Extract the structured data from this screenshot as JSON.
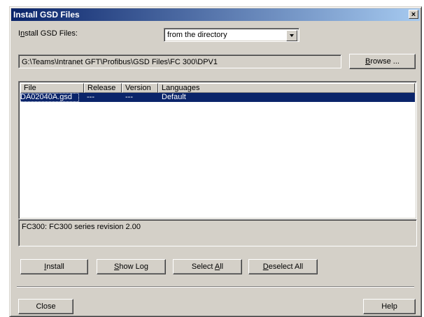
{
  "window": {
    "title": "Install GSD Files"
  },
  "install": {
    "label_prefix": "I",
    "label_accel": "n",
    "label_rest": "stall GSD Files:",
    "source_value": "from the directory"
  },
  "path": {
    "value": "G:\\Teams\\Intranet GFT\\Profibus\\GSD Files\\FC 300\\DPV1"
  },
  "browse": {
    "accel": "B",
    "rest": "rowse ..."
  },
  "table": {
    "columns": [
      "File",
      "Release",
      "Version",
      "Languages"
    ],
    "rows": [
      {
        "file": "DA02040A.gsd",
        "release": "---",
        "version": "---",
        "languages": "Default"
      }
    ]
  },
  "info": {
    "text": "FC300: FC300 series revision 2.00"
  },
  "actions": {
    "install": {
      "accel": "I",
      "rest": "nstall"
    },
    "show_log": {
      "accel": "S",
      "rest": "how Log"
    },
    "select_all": {
      "before": "Select ",
      "accel": "A",
      "rest": "ll"
    },
    "deselect_all": {
      "accel": "D",
      "rest": "eselect All"
    }
  },
  "footer": {
    "close": "Close",
    "help": "Help"
  }
}
